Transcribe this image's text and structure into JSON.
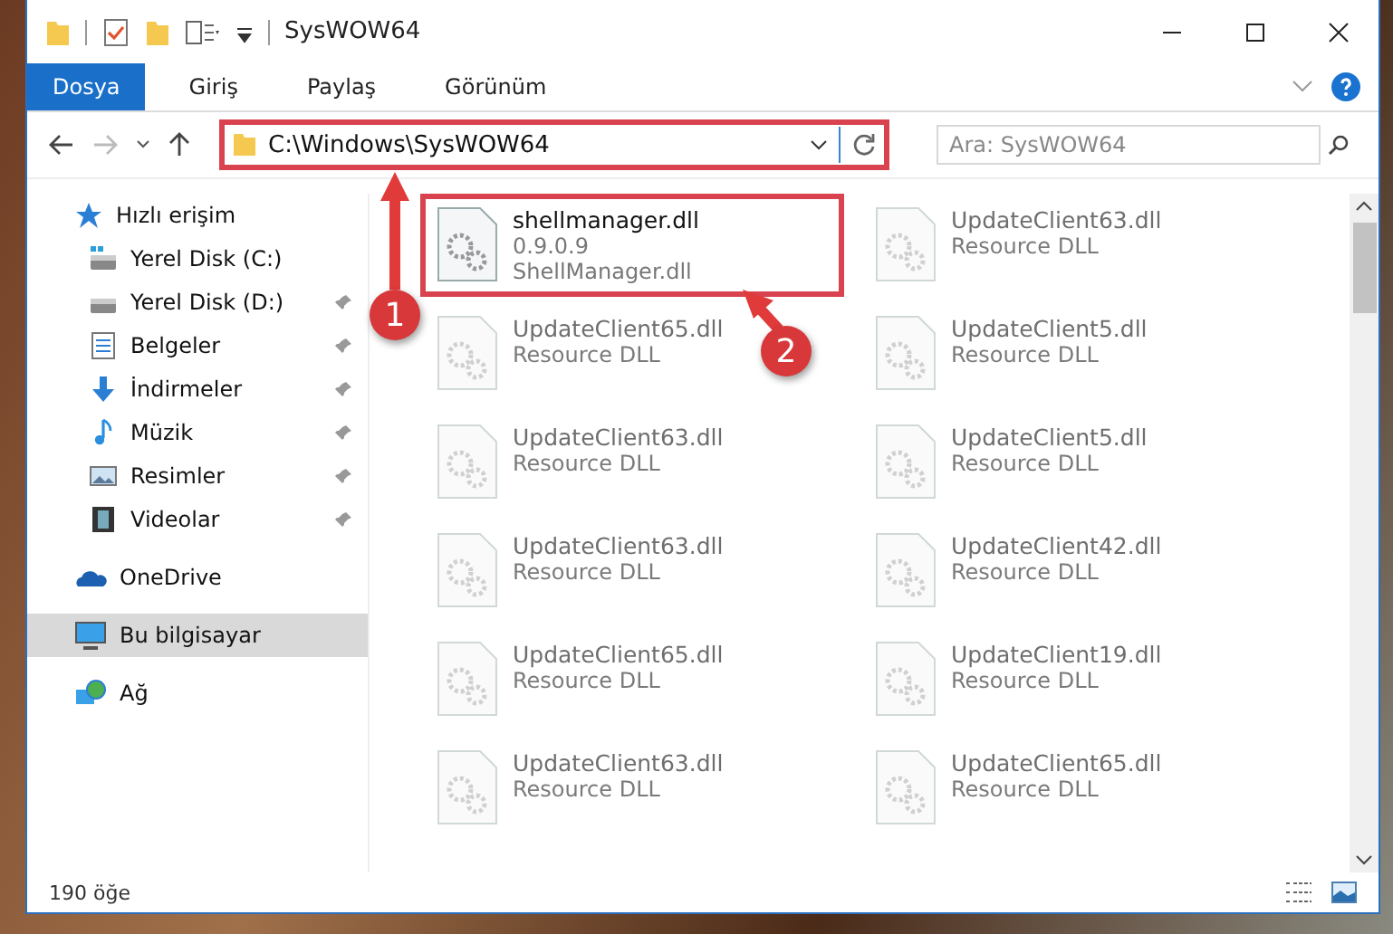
{
  "window": {
    "title": "SysWOW64"
  },
  "ribbon_tabs": [
    {
      "label": "Dosya",
      "selected": true
    },
    {
      "label": "Giriş",
      "selected": false
    },
    {
      "label": "Paylaş",
      "selected": false
    },
    {
      "label": "Görünüm",
      "selected": false
    }
  ],
  "address_bar": {
    "path": "C:\\Windows\\SysWOW64",
    "highlighted": true
  },
  "search": {
    "placeholder": "Ara: SysWOW64"
  },
  "sidebar": {
    "items": [
      {
        "kind": "star",
        "label": "Hızlı erişim",
        "selected": false,
        "children": [
          {
            "kind": "drive-c",
            "label": "Yerel Disk (C:)",
            "pinned": false,
            "selected": false
          },
          {
            "kind": "drive",
            "label": "Yerel Disk (D:)",
            "pinned": true,
            "selected": false
          },
          {
            "kind": "documents",
            "label": "Belgeler",
            "pinned": true,
            "selected": false
          },
          {
            "kind": "download",
            "label": "İndirmeler",
            "pinned": true,
            "selected": false
          },
          {
            "kind": "music",
            "label": "Müzik",
            "pinned": true,
            "selected": false
          },
          {
            "kind": "pictures",
            "label": "Resimler",
            "pinned": true,
            "selected": false
          },
          {
            "kind": "videos",
            "label": "Videolar",
            "pinned": true,
            "selected": false
          }
        ]
      },
      {
        "kind": "cloud",
        "label": "OneDrive",
        "selected": false
      },
      {
        "kind": "computer",
        "label": "Bu bilgisayar",
        "selected": true
      },
      {
        "kind": "network",
        "label": "Ağ",
        "selected": false
      }
    ]
  },
  "files": [
    {
      "name": "shellmanager.dll",
      "details": [
        "0.9.0.9",
        "ShellManager.dll"
      ],
      "faded": false,
      "highlighted": true
    },
    {
      "name": "UpdateClient63.dll",
      "details": [
        "Resource DLL"
      ],
      "faded": true,
      "highlighted": false
    },
    {
      "name": "UpdateClient65.dll",
      "details": [
        "Resource DLL"
      ],
      "faded": true,
      "highlighted": false
    },
    {
      "name": "UpdateClient5.dll",
      "details": [
        "Resource DLL"
      ],
      "faded": true,
      "highlighted": false
    },
    {
      "name": "UpdateClient63.dll",
      "details": [
        "Resource DLL"
      ],
      "faded": true,
      "highlighted": false
    },
    {
      "name": "UpdateClient5.dll",
      "details": [
        "Resource DLL"
      ],
      "faded": true,
      "highlighted": false
    },
    {
      "name": "UpdateClient63.dll",
      "details": [
        "Resource DLL"
      ],
      "faded": true,
      "highlighted": false
    },
    {
      "name": "UpdateClient42.dll",
      "details": [
        "Resource DLL"
      ],
      "faded": true,
      "highlighted": false
    },
    {
      "name": "UpdateClient65.dll",
      "details": [
        "Resource DLL"
      ],
      "faded": true,
      "highlighted": false
    },
    {
      "name": "UpdateClient19.dll",
      "details": [
        "Resource DLL"
      ],
      "faded": true,
      "highlighted": false
    },
    {
      "name": "UpdateClient63.dll",
      "details": [
        "Resource DLL"
      ],
      "faded": true,
      "highlighted": false
    },
    {
      "name": "UpdateClient65.dll",
      "details": [
        "Resource DLL"
      ],
      "faded": true,
      "highlighted": false
    }
  ],
  "status_bar": {
    "item_count": "190 öğe"
  },
  "callouts": [
    {
      "number": "1"
    },
    {
      "number": "2"
    }
  ]
}
